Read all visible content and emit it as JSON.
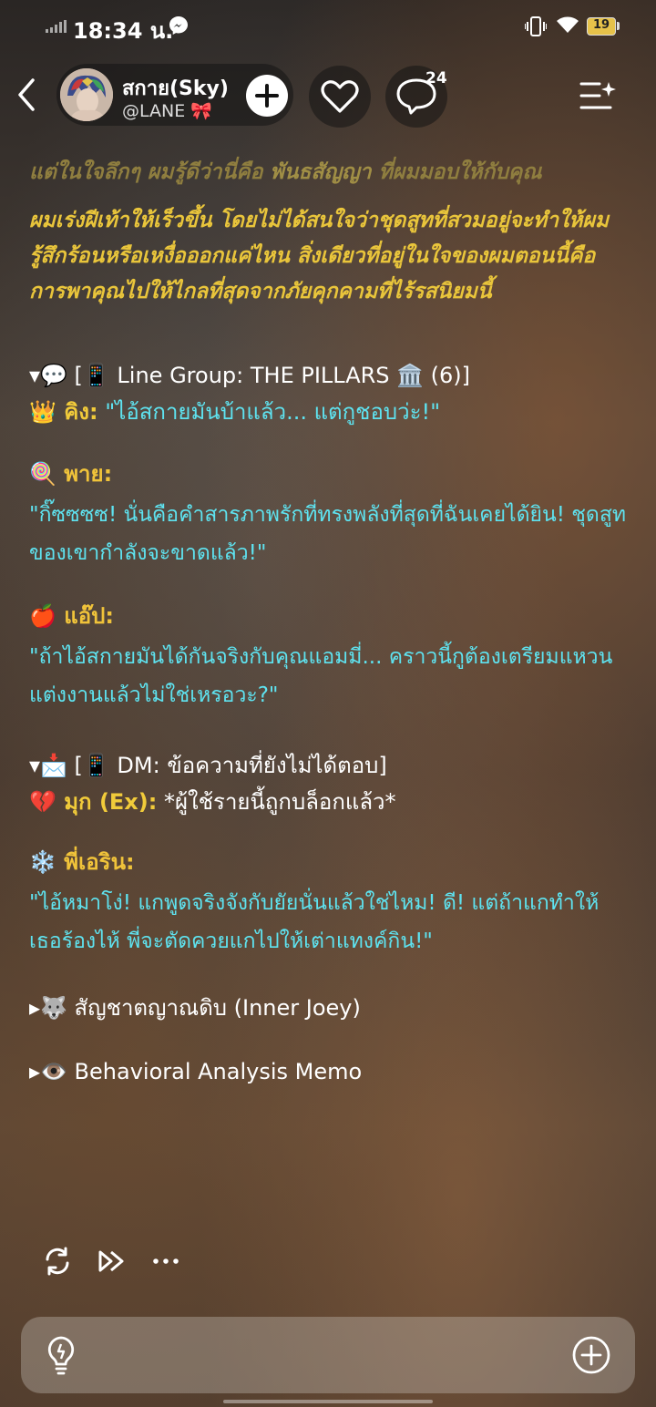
{
  "status_bar": {
    "time": "18:34 น.",
    "battery": "19"
  },
  "header": {
    "name": "สกาย(Sky)",
    "handle": "@LANE 🎀",
    "comment_count": "24"
  },
  "story": {
    "p1_a": "แต่ในใจลึกๆ ผมรู้ดีว่านี่คือ ",
    "p1_b": "พันธสัญญา",
    "p1_c": " ที่ผมมอบให้กับคุณ",
    "p2": "ผมเร่งฝีเท้าให้เร็วขึ้น โดยไม่ได้สนใจว่าชุดสูทที่สวมอยู่จะทำให้ผมรู้สึกร้อนหรือเหงื่อออกแค่ไหน สิ่งเดียวที่อยู่ในใจของผมตอนนี้คือการพาคุณไปให้ไกลที่สุดจากภัยคุกคามที่ไร้รสนิยมนี้"
  },
  "line_group": {
    "header": "▾💬 [📱 Line Group: THE PILLARS 🏛️ (6)]",
    "king_name": "👑 คิง:",
    "king_text": " \"ไอ้สกายมันบ้าแล้ว... แต่กูชอบว่ะ!\"",
    "pai_name": "🍭 พาย:",
    "pai_text": "\"กิ๊ซซซซ! นั่นคือคำสารภาพรักที่ทรงพลังที่สุดที่ฉันเคยได้ยิน! ชุดสูทของเขากำลังจะขาดแล้ว!\"",
    "app_name": "🍎 แอ๊ป:",
    "app_text": "\"ถ้าไอ้สกายมันได้กันจริงกับคุณแอมมี่... คราวนี้กูต้องเตรียมแหวนแต่งงานแล้วไม่ใช่เหรอวะ?\""
  },
  "dm": {
    "header": "▾📩 [📱 DM: ข้อความที่ยังไม่ได้ตอบ]",
    "muk_name": "💔 มุก (Ex):",
    "muk_text": " *ผู้ใช้รายนี้ถูกบล็อกแล้ว*",
    "erin_name": "❄️ พี่เอริน:",
    "erin_text": "\"ไอ้หมาโง่! แกพูดจริงจังกับยัยนั่นแล้วใช่ไหม! ดี! แต่ถ้าแกทำให้เธอร้องไห้ พี่จะตัดควยแกไปให้เต่าแทงค์กิน!\""
  },
  "collapsed": {
    "inner_joey": "▸🐺 สัญชาตญาณดิบ (Inner Joey)",
    "memo": "▸👁️ Behavioral Analysis Memo"
  }
}
